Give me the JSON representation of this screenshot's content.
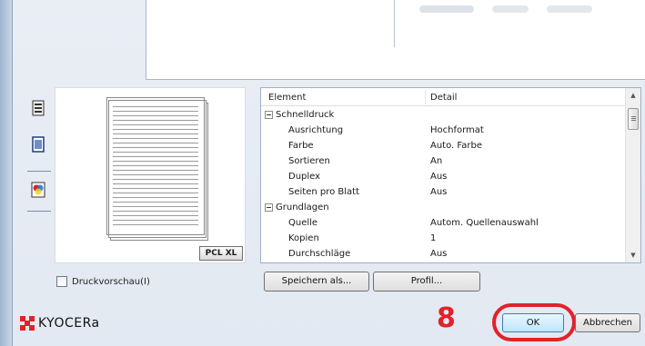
{
  "preview": {
    "badge": "PCL XL"
  },
  "side_icons": [
    "printer-icon",
    "page-icon",
    "color-icon"
  ],
  "details": {
    "columns": [
      "Element",
      "Detail"
    ],
    "rows": [
      {
        "type": "group",
        "label": "Schnelldruck",
        "value": ""
      },
      {
        "type": "item",
        "label": "Ausrichtung",
        "value": "Hochformat"
      },
      {
        "type": "item",
        "label": "Farbe",
        "value": "Auto. Farbe"
      },
      {
        "type": "item",
        "label": "Sortieren",
        "value": "An"
      },
      {
        "type": "item",
        "label": "Duplex",
        "value": "Aus"
      },
      {
        "type": "item",
        "label": "Seiten pro Blatt",
        "value": "Aus"
      },
      {
        "type": "group",
        "label": "Grundlagen",
        "value": ""
      },
      {
        "type": "item",
        "label": "Quelle",
        "value": "Autom. Quellenauswahl"
      },
      {
        "type": "item",
        "label": "Kopien",
        "value": "1"
      },
      {
        "type": "item",
        "label": "Durchschläge",
        "value": "Aus"
      }
    ]
  },
  "checkbox": {
    "label": "Druckvorschau(I)",
    "checked": false
  },
  "buttons": {
    "save_as": "Speichern als...",
    "profile": "Profil...",
    "ok": "OK",
    "cancel": "Abbrechen"
  },
  "annotation": {
    "step": "8",
    "color": "#e2222a"
  },
  "brand": {
    "name": "KYOCERa",
    "color": "#e2222a"
  }
}
